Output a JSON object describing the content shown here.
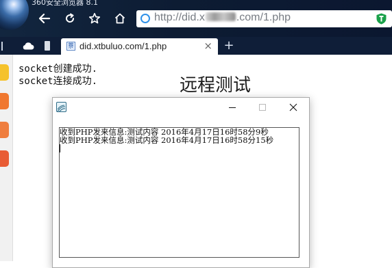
{
  "browser": {
    "window_title": "360安全浏览器 8.1",
    "url_prefix": "http://did.x",
    "url_suffix": ".com/1.php",
    "tab_title": "did.xtbuluo.com/1.php",
    "tab_favicon": "萘",
    "icons": [
      "back-arrow-icon",
      "refresh-icon",
      "star-icon",
      "home-icon",
      "page-load-icon",
      "shield-icon",
      "cloud-icon",
      "phone-icon",
      "close-icon",
      "plus-icon"
    ],
    "colors": {
      "chrome": "#0f1e38",
      "shield": "#1aa14a",
      "url_ring": "#2e90e8"
    }
  },
  "page": {
    "log": [
      "socket创建成功.",
      "socket连接成功."
    ],
    "heading": "远程测试"
  },
  "dialog": {
    "messages": [
      "收到PHP发来信息:测试内容   2016年4月17日16时58分9秒",
      "收到PHP发来信息:测试内容   2016年4月17日16时58分15秒"
    ],
    "icons": [
      "app-icon",
      "minimize-icon",
      "maximize-icon",
      "close-icon"
    ]
  }
}
